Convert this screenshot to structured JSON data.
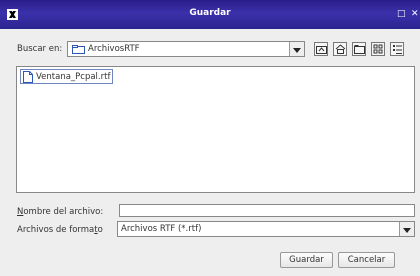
{
  "window": {
    "title": "Guardar",
    "buttons": [
      "□",
      "✕"
    ]
  },
  "lookin": {
    "label": "Buscar en:",
    "value": "ArchivosRTF"
  },
  "toolbar": {
    "icons": [
      "up-folder-icon",
      "home-icon",
      "new-folder-icon",
      "list-view-icon",
      "details-view-icon"
    ]
  },
  "files": [
    {
      "name": "Ventana_Pcpal.rtf"
    }
  ],
  "filename": {
    "label_pre": "N",
    "label_rest": "ombre del archivo:",
    "value": ""
  },
  "filetype": {
    "label_pre": "Archivos de forma",
    "label_u": "t",
    "label_post": "o",
    "value": "Archivos RTF (*.rtf)"
  },
  "actions": {
    "save": "Guardar",
    "cancel": "Cancelar"
  }
}
